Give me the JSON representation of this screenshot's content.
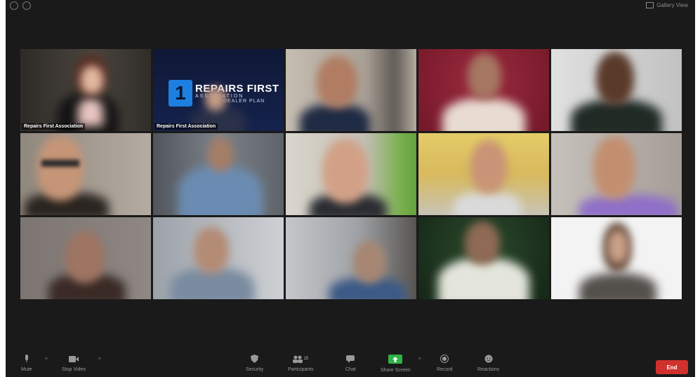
{
  "topbar": {
    "view_label": "Gallery View"
  },
  "tiles": [
    {
      "name_label": "Repairs First Association",
      "bg": "#3b3733"
    },
    {
      "name_label": "Repairs First Association",
      "bg": "#101a3c",
      "logo_text": "REPAIRS FIRST",
      "logo_sub": "ASSOCIATION",
      "logo_extra": "DEALER PLAN"
    },
    {
      "name_label": "",
      "bg": "#b9b2a8"
    },
    {
      "name_label": "",
      "bg": "#8c1f33"
    },
    {
      "name_label": "",
      "bg": "#cfcfcf"
    },
    {
      "name_label": "",
      "bg": "#9a9288"
    },
    {
      "name_label": "",
      "bg": "#6b7077"
    },
    {
      "name_label": "",
      "bg": "#c9c4b8"
    },
    {
      "name_label": "",
      "bg": "#d8c36a"
    },
    {
      "name_label": "",
      "bg": "#b9b3ae"
    },
    {
      "name_label": "",
      "bg": "#7a7471"
    },
    {
      "name_label": "",
      "bg": "#9aa0a8"
    },
    {
      "name_label": "",
      "bg": "#a6a9ad"
    },
    {
      "name_label": "",
      "bg": "#1f3a22"
    },
    {
      "name_label": "",
      "bg": "#f1f1f1"
    }
  ],
  "toolbar": {
    "mute": "Mute",
    "stop_video": "Stop Video",
    "security": "Security",
    "participants": "Participants",
    "participants_count": "15",
    "chat": "Chat",
    "share_screen": "Share Screen",
    "record": "Record",
    "reactions": "Reactions",
    "end": "End"
  },
  "colors": {
    "background": "#1a1a1a",
    "share_green": "#2fb344",
    "end_red": "#d0312d"
  }
}
